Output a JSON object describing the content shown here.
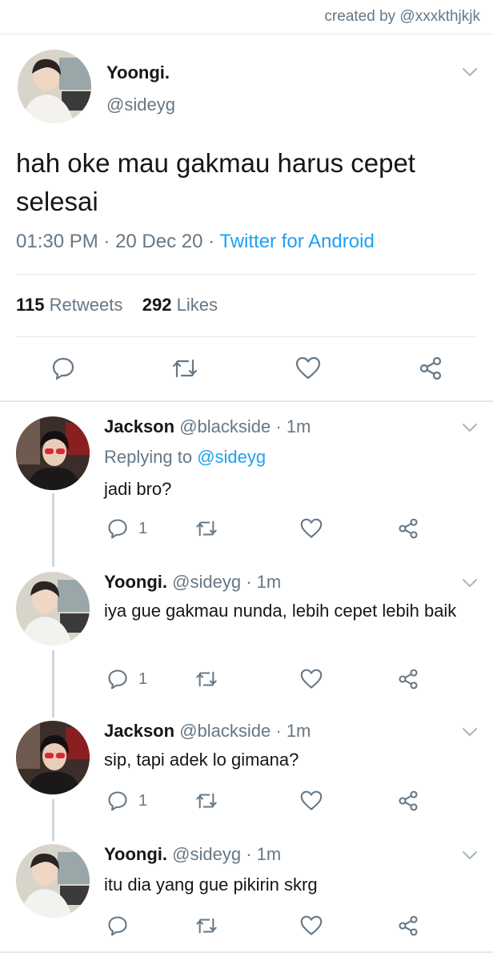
{
  "credit": "created by @xxxkthjkjk",
  "main_tweet": {
    "name": "Yoongi.",
    "handle": "@sideyg",
    "text": "hah oke mau gakmau harus cepet selesai",
    "time": "01:30 PM",
    "date": "20 Dec 20",
    "source": "Twitter for Android",
    "retweets": "115",
    "retweets_label": "Retweets",
    "likes": "292",
    "likes_label": "Likes"
  },
  "replies": [
    {
      "name": "Jackson",
      "handle": "@blackside",
      "time": "1m",
      "replying_label": "Replying to",
      "replying_to": "@sideyg",
      "text": "jadi bro?",
      "reply_count": "1"
    },
    {
      "name": "Yoongi.",
      "handle": "@sideyg",
      "time": "1m",
      "text": "iya gue gakmau nunda, lebih cepet lebih baik",
      "reply_count": "1"
    },
    {
      "name": "Jackson",
      "handle": "@blackside",
      "time": "1m",
      "text": "sip, tapi adek lo gimana?",
      "reply_count": "1"
    },
    {
      "name": "Yoongi.",
      "handle": "@sideyg",
      "time": "1m",
      "text": "itu dia yang gue pikirin skrg",
      "reply_count": ""
    }
  ],
  "separators": {
    "dot": " · "
  },
  "colors": {
    "link": "#1da1f2",
    "muted": "#657786",
    "text": "#14171a",
    "divider": "#e1e8ed"
  }
}
